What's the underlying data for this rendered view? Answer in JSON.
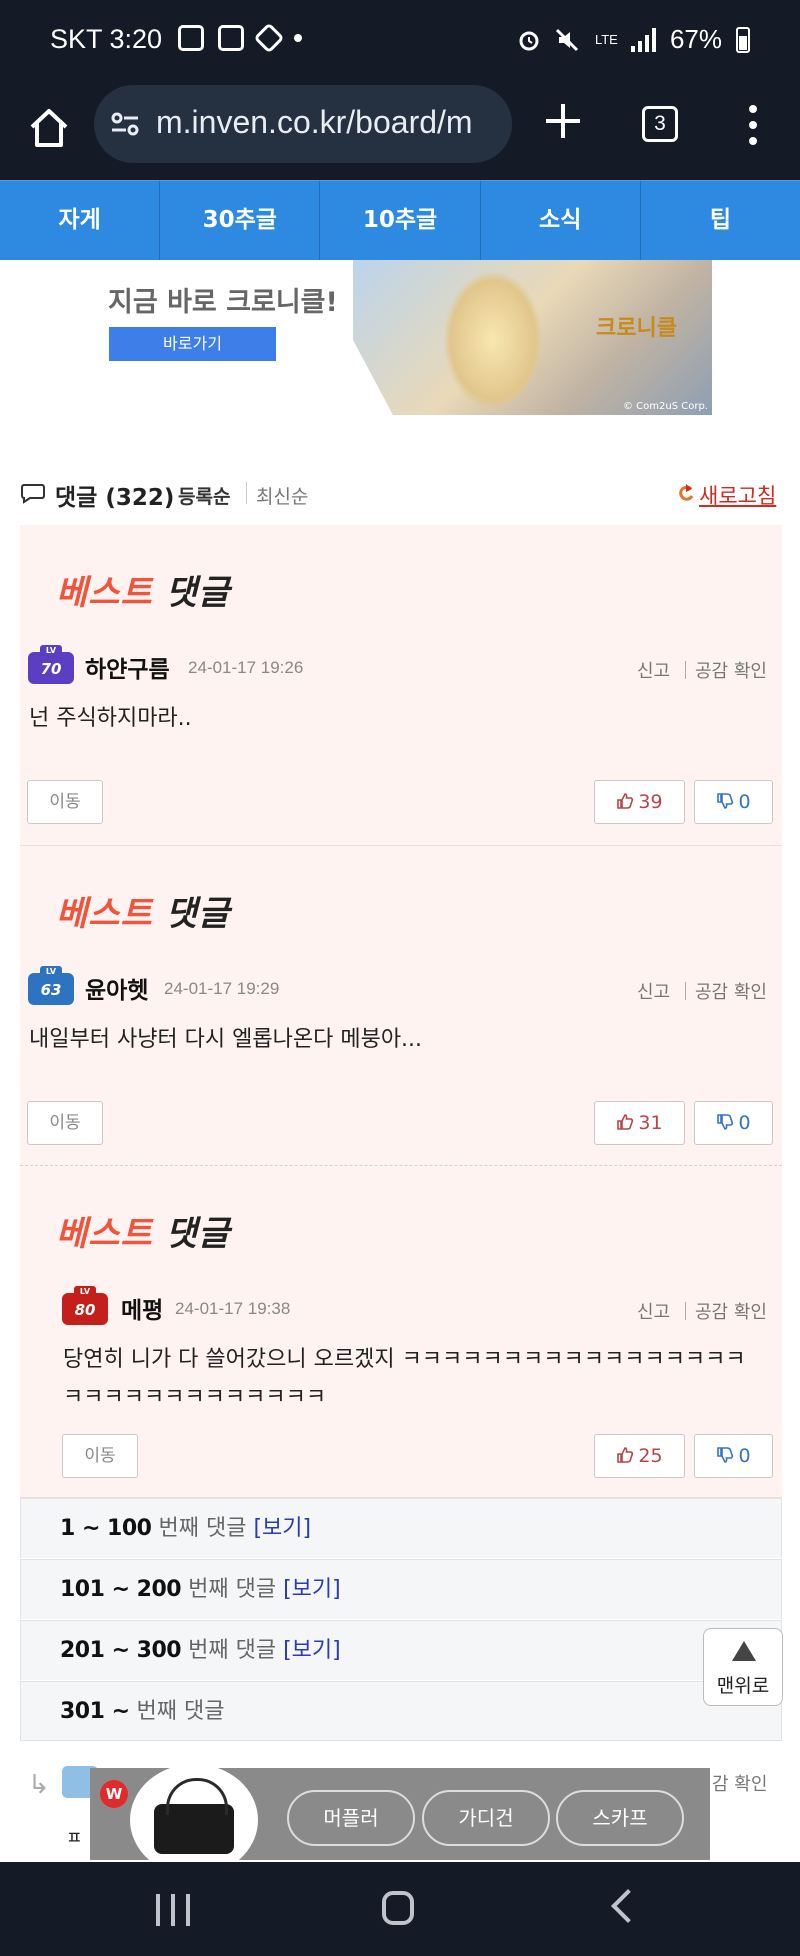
{
  "status_bar": {
    "carrier_time": "SKT 3:20",
    "network": "LTE",
    "battery": "67%",
    "battery_level": 0.67
  },
  "browser": {
    "url": "m.inven.co.kr/board/m",
    "tab_count": "3"
  },
  "nav_tabs": [
    "자게",
    "30추글",
    "10추글",
    "소식",
    "팁"
  ],
  "banner": {
    "headline": "지금 바로 크로니클!",
    "button": "바로가기",
    "logo_text": "크로니클",
    "copyright": "© Com2uS Corp."
  },
  "comments_header": {
    "title": "댓글",
    "count": "(322)",
    "sort_register": "등록순",
    "sort_latest": "최신순",
    "refresh": "새로고침"
  },
  "best_label": {
    "part1": "베스트",
    "part2": "댓글"
  },
  "actions": {
    "report": "신고",
    "empathy": "공감 확인",
    "move": "이동"
  },
  "best_comments": [
    {
      "level": "70",
      "author": "하얀구름",
      "time": "24-01-17 19:26",
      "text": "넌 주식하지마라..",
      "likes": "39",
      "dislikes": "0"
    },
    {
      "level": "63",
      "author": "윤아헷",
      "time": "24-01-17 19:29",
      "text": "내일부터 사냥터 다시 엘롭나온다 메붕아...",
      "likes": "31",
      "dislikes": "0"
    },
    {
      "level": "80",
      "author": "메평",
      "time": "24-01-17 19:38",
      "text_line1": "당연히 니가 다 쓸어갔으니 오르겠지 ㅋㅋㅋㅋㅋㅋㅋㅋㅋㅋㅋㅋㅋㅋㅋㅋㅋ",
      "text_line2": "ㅋㅋㅋㅋㅋㅋㅋㅋㅋㅋㅋㅋㅋ",
      "likes": "25",
      "dislikes": "0"
    }
  ],
  "page_ranges": [
    {
      "nums": "1 ~ 100",
      "label": " 번째 댓글 ",
      "view": "[보기]"
    },
    {
      "nums": "101 ~ 200",
      "label": " 번째 댓글 ",
      "view": "[보기]"
    },
    {
      "nums": "201 ~ 300",
      "label": " 번째 댓글 ",
      "view": "[보기]"
    },
    {
      "nums": "301 ~",
      "label": " 번째 댓글",
      "view": ""
    }
  ],
  "top_button": "맨위로",
  "peek": {
    "empathy": "감 확인",
    "text": "ㅍ"
  },
  "ad": {
    "badge": "W",
    "chips": [
      "머플러",
      "가디건",
      "스카프"
    ]
  },
  "colors": {
    "system_bar": "#141b26",
    "nav_tab_bg": "#2d8ae0",
    "best_bg": "#fff3f1",
    "refresh": "#d12a1e",
    "like": "#b8454a",
    "dislike": "#3573c9"
  }
}
